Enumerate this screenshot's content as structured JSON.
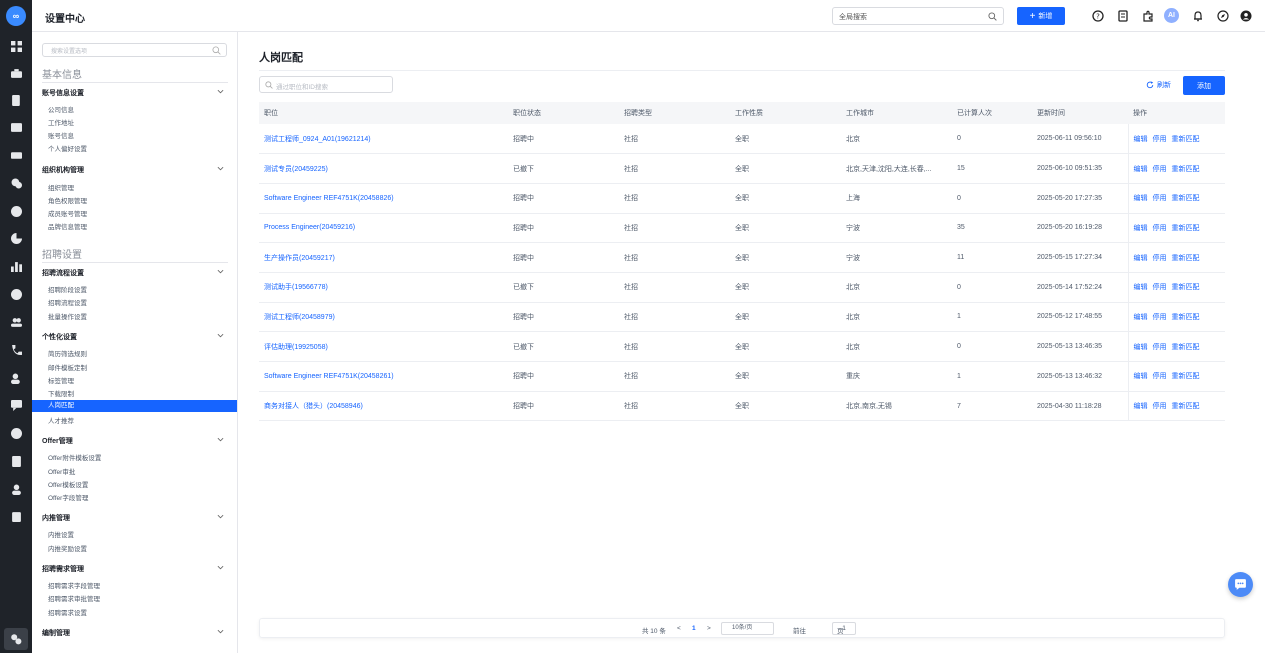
{
  "app": {
    "title": "设置中心",
    "global_search_placeholder": "全局搜索",
    "new_label": "新增",
    "ai_label": "AI"
  },
  "sidebar": {
    "search_placeholder": "搜索设置选项",
    "sections": [
      {
        "title": "基本信息"
      },
      {
        "title": "招聘设置"
      }
    ],
    "groups": [
      {
        "label": "账号信息设置",
        "items": [
          "公司信息",
          "工作地址",
          "账号信息",
          "个人偏好设置"
        ]
      },
      {
        "label": "组织机构管理",
        "items": [
          "组织管理",
          "角色权限管理",
          "成员账号管理",
          "品牌信息管理"
        ]
      },
      {
        "label": "招聘流程设置",
        "items": [
          "招聘阶段设置",
          "招聘流程设置",
          "批量操作设置"
        ]
      },
      {
        "label": "个性化设置",
        "items": [
          "简历筛选规则",
          "邮件模板定制",
          "标签管理",
          "下载限制",
          "人岗匹配",
          "人才推荐"
        ]
      },
      {
        "label": "Offer管理",
        "items": [
          "Offer附件模板设置",
          "Offer审批",
          "Offer模板设置",
          "Offer字段管理"
        ]
      },
      {
        "label": "内推管理",
        "items": [
          "内推设置",
          "内推奖励设置"
        ]
      },
      {
        "label": "招聘需求管理",
        "items": [
          "招聘需求字段管理",
          "招聘需求审批管理",
          "招聘需求设置"
        ]
      },
      {
        "label": "编制管理",
        "items": []
      }
    ],
    "active_item": "人岗匹配"
  },
  "main": {
    "title": "人岗匹配",
    "search_placeholder": "通过职位和ID搜索",
    "refresh_label": "刷新",
    "add_label": "添加",
    "columns": [
      "职位",
      "职位状态",
      "招聘类型",
      "工作性质",
      "工作城市",
      "已计算人次",
      "更新时间",
      "操作"
    ],
    "row_actions": [
      "编辑",
      "停用",
      "重新匹配"
    ],
    "rows": [
      [
        "测试工程师_0924_A01(19621214)",
        "招聘中",
        "社招",
        "全职",
        "北京",
        "0",
        "2025-06-11 09:56:10"
      ],
      [
        "测试专员(20459225)",
        "已撤下",
        "社招",
        "全职",
        "北京,天津,沈阳,大连,长春,...",
        "15",
        "2025-06-10 09:51:35"
      ],
      [
        "Software Engineer REF4751K(20458826)",
        "招聘中",
        "社招",
        "全职",
        "上海",
        "0",
        "2025-05-20 17:27:35"
      ],
      [
        "Process Engineer(20459216)",
        "招聘中",
        "社招",
        "全职",
        "宁波",
        "35",
        "2025-05-20 16:19:28"
      ],
      [
        "生产操作员(20459217)",
        "招聘中",
        "社招",
        "全职",
        "宁波",
        "11",
        "2025-05-15 17:27:34"
      ],
      [
        "测试助手(19566778)",
        "已撤下",
        "社招",
        "全职",
        "北京",
        "0",
        "2025-05-14 17:52:24"
      ],
      [
        "测试工程师(20458979)",
        "招聘中",
        "社招",
        "全职",
        "北京",
        "1",
        "2025-05-12 17:48:55"
      ],
      [
        "评估助理(19925058)",
        "已撤下",
        "社招",
        "全职",
        "北京",
        "0",
        "2025-05-13 13:46:35"
      ],
      [
        "Software Engineer REF4751K(20458261)",
        "招聘中",
        "社招",
        "全职",
        "重庆",
        "1",
        "2025-05-13 13:46:32"
      ],
      [
        "商务对接人（猎头）(20458946)",
        "招聘中",
        "社招",
        "全职",
        "北京,南京,无锡",
        "7",
        "2025-04-30 11:18:28"
      ]
    ]
  },
  "pagination": {
    "total_text": "共 10 条",
    "prev": "<",
    "current_page": "1",
    "next": ">",
    "page_size": "10条/页",
    "goto_label": "前往",
    "goto_value": "1",
    "page_unit": "页"
  },
  "colors": {
    "accent": "#1664ff",
    "rail": "#1f2329"
  }
}
